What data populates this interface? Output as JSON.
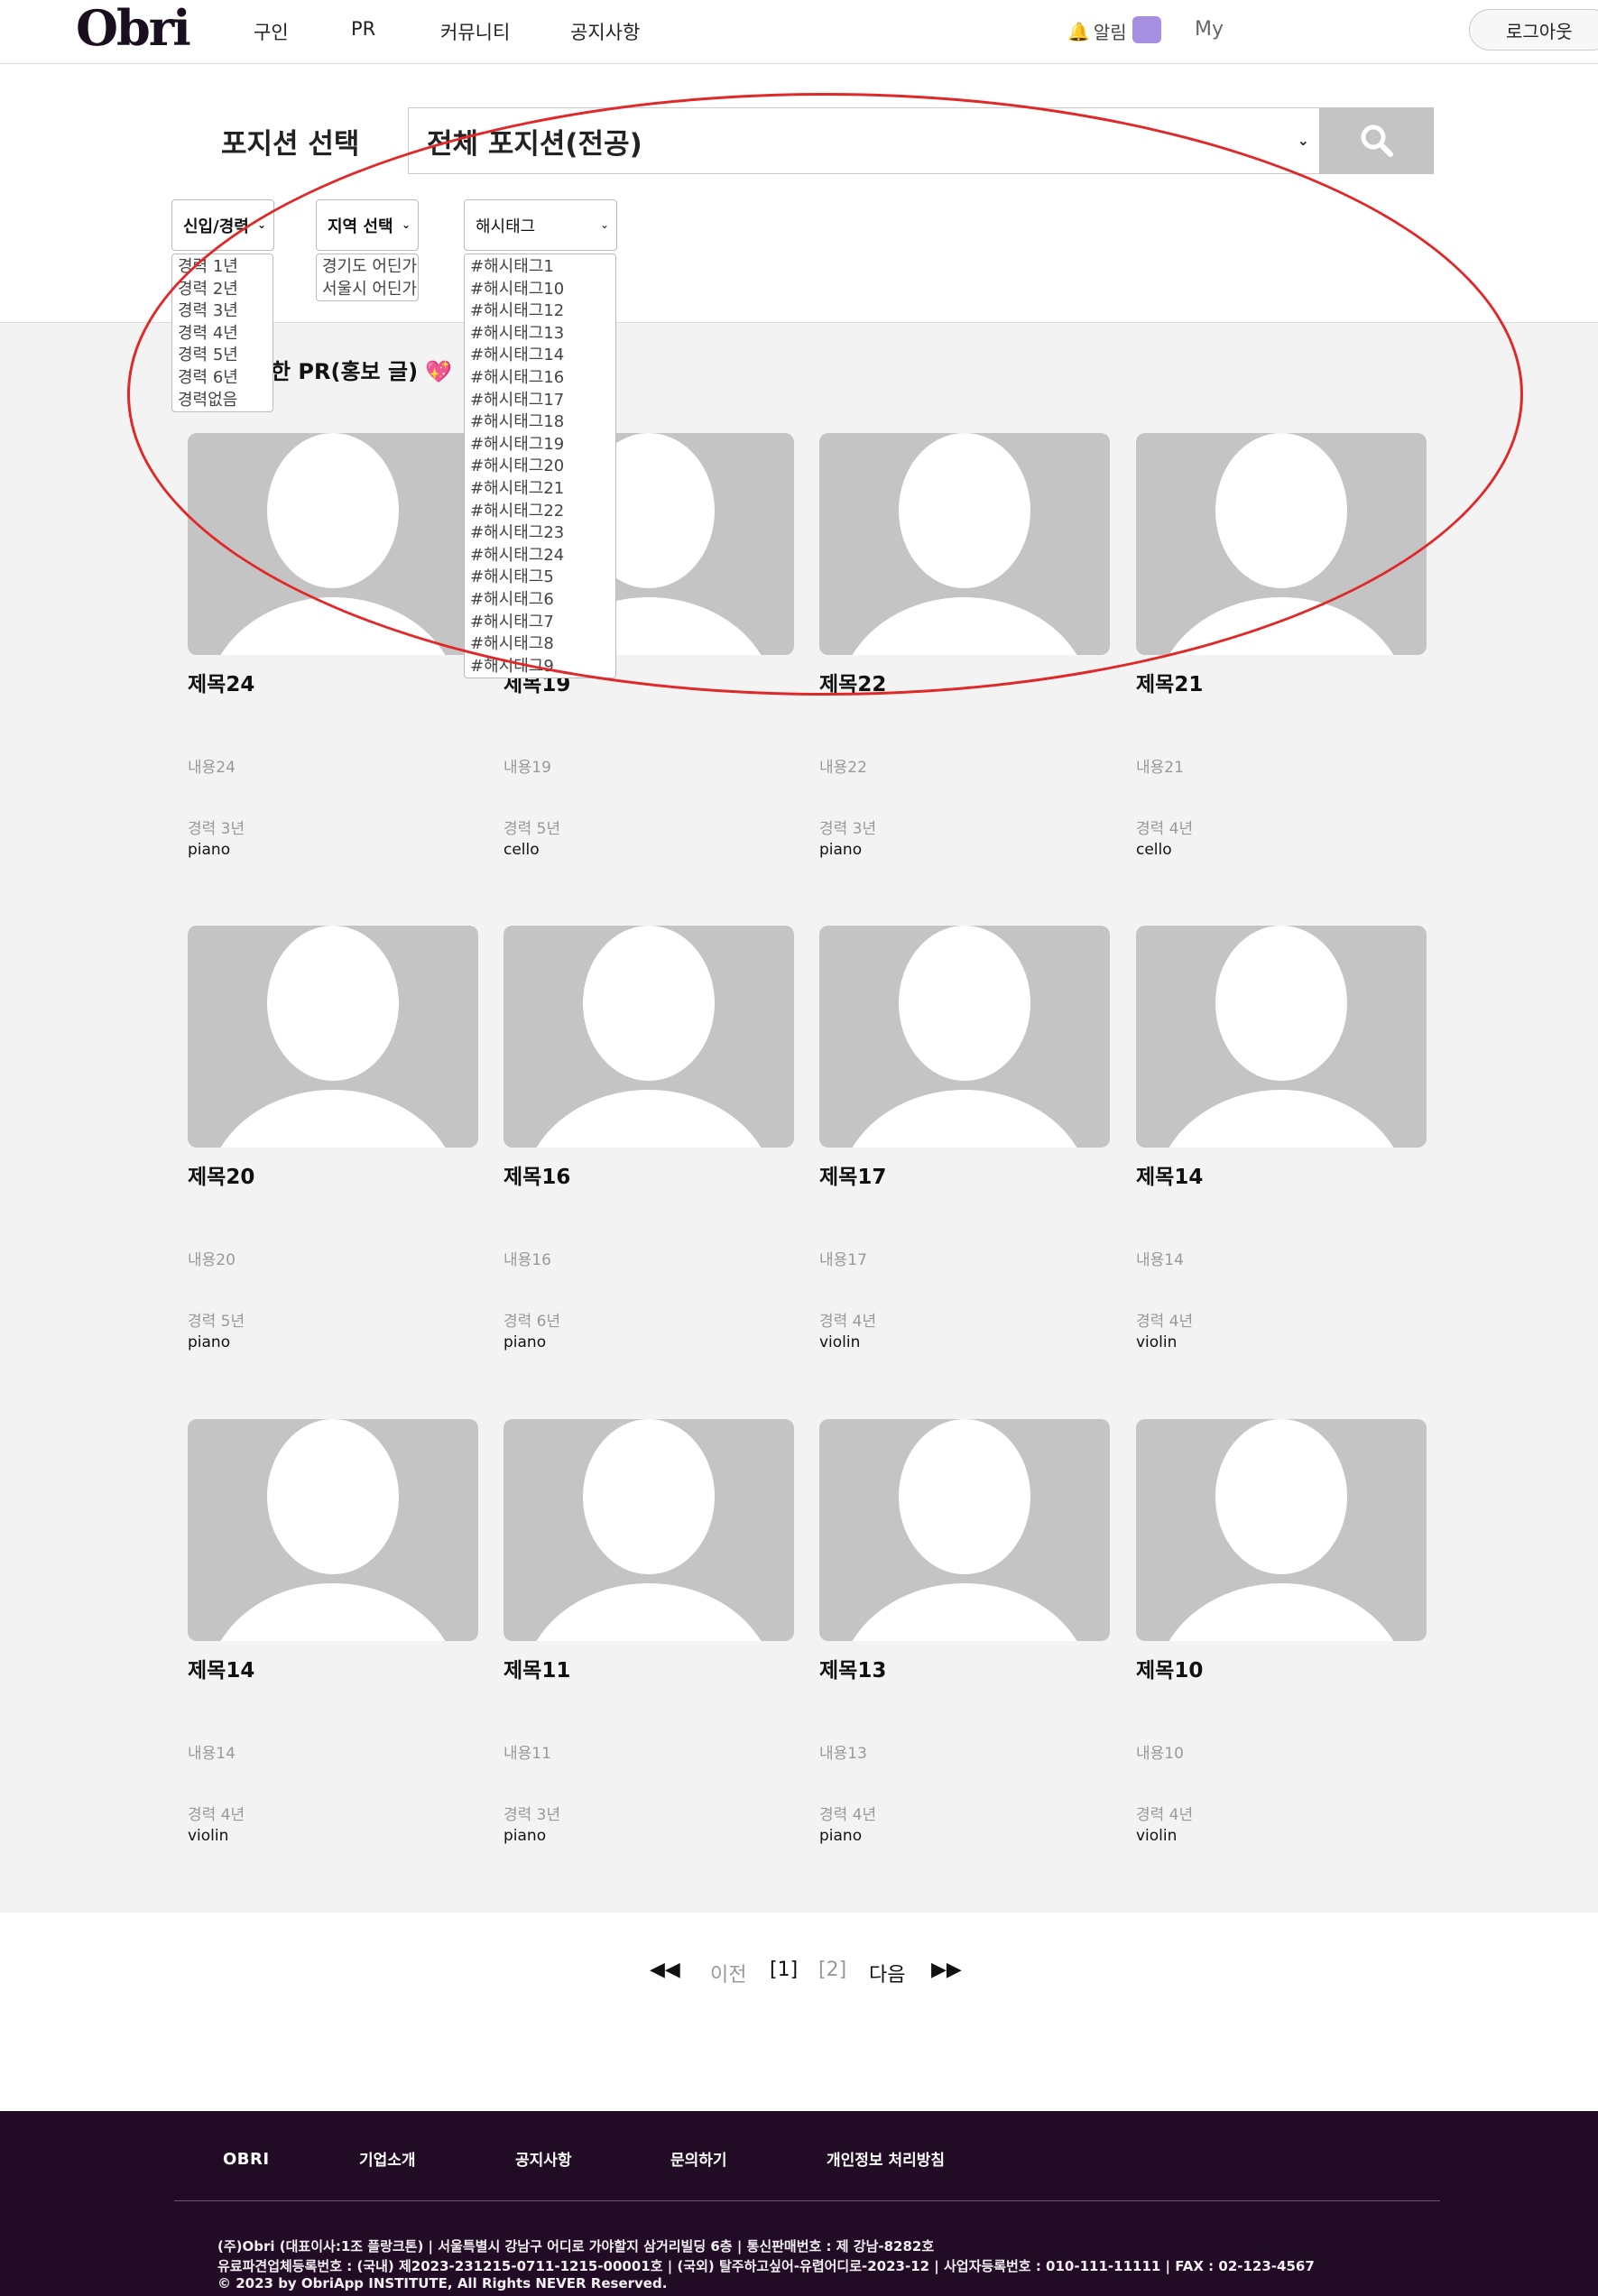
{
  "header": {
    "logo": "Obri",
    "nav": [
      "구인",
      "PR",
      "커뮤니티",
      "공지사항"
    ],
    "alarm_label": "알림",
    "my_label": "My",
    "logout_label": "로그아웃"
  },
  "filters": {
    "position_label": "포지션 선택",
    "position_value": "전체 포지션(전공)",
    "career": {
      "label": "신입/경력",
      "options": [
        "경력 1년",
        "경력 2년",
        "경력 3년",
        "경력 4년",
        "경력 5년",
        "경력 6년",
        "경력없음"
      ]
    },
    "region": {
      "label": "지역 선택",
      "options": [
        "경기도 어딘가",
        "서울시 어딘가"
      ]
    },
    "hashtag": {
      "label": "해시태그",
      "options": [
        "#해시태그1",
        "#해시태그10",
        "#해시태그12",
        "#해시태그13",
        "#해시태그14",
        "#해시태그16",
        "#해시태그17",
        "#해시태그18",
        "#해시태그19",
        "#해시태그20",
        "#해시태그21",
        "#해시태그22",
        "#해시태그23",
        "#해시태그24",
        "#해시태그5",
        "#해시태그6",
        "#해시태그7",
        "#해시태그8",
        "#해시태그9"
      ]
    }
  },
  "section": {
    "title": "한 PR(홍보 글)",
    "heart": "💖"
  },
  "cards": [
    {
      "title": "제목24",
      "content": "내용24",
      "career": "경력 3년",
      "instrument": "piano"
    },
    {
      "title": "제목19",
      "content": "내용19",
      "career": "경력 5년",
      "instrument": "cello"
    },
    {
      "title": "제목22",
      "content": "내용22",
      "career": "경력 3년",
      "instrument": "piano"
    },
    {
      "title": "제목21",
      "content": "내용21",
      "career": "경력 4년",
      "instrument": "cello"
    },
    {
      "title": "제목20",
      "content": "내용20",
      "career": "경력 5년",
      "instrument": "piano"
    },
    {
      "title": "제목16",
      "content": "내용16",
      "career": "경력 6년",
      "instrument": "piano"
    },
    {
      "title": "제목17",
      "content": "내용17",
      "career": "경력 4년",
      "instrument": "violin"
    },
    {
      "title": "제목14",
      "content": "내용14",
      "career": "경력 4년",
      "instrument": "violin"
    },
    {
      "title": "제목14",
      "content": "내용14",
      "career": "경력 4년",
      "instrument": "violin"
    },
    {
      "title": "제목11",
      "content": "내용11",
      "career": "경력 3년",
      "instrument": "piano"
    },
    {
      "title": "제목13",
      "content": "내용13",
      "career": "경력 4년",
      "instrument": "piano"
    },
    {
      "title": "제목10",
      "content": "내용10",
      "career": "경력 4년",
      "instrument": "violin"
    }
  ],
  "pagination": {
    "first": "◀◀",
    "prev": "이전",
    "page1": "[1]",
    "page2": "[2]",
    "next": "다음",
    "last": "▶▶"
  },
  "footer": {
    "logo": "OBRI",
    "links": [
      "기업소개",
      "공지사항",
      "문의하기",
      "개인정보 처리방침"
    ],
    "info_line1": "(주)Obri (대표이사:1조 플랑크톤) | 서울특별시 강남구 어디로 가야할지 삼거리빌딩 6층 | 통신판매번호 : 제 강남-8282호",
    "info_line2": "유료파견업체등록번호 : (국내) 제2023-231215-0711-1215-00001호 | (국외) 탈주하고싶어-유렵어디로-2023-12 | 사업자등록번호 : 010-111-11111 | FAX : 02-123-4567",
    "info_line3": "© 2023 by ObriApp INSTITUTE, All Rights NEVER Reserved."
  },
  "colors": {
    "footer_bg": "#220c25",
    "placeholder_grey": "#c4c4c4",
    "annotation_red": "#e12828",
    "avatar_purple": "#a58fe0"
  }
}
